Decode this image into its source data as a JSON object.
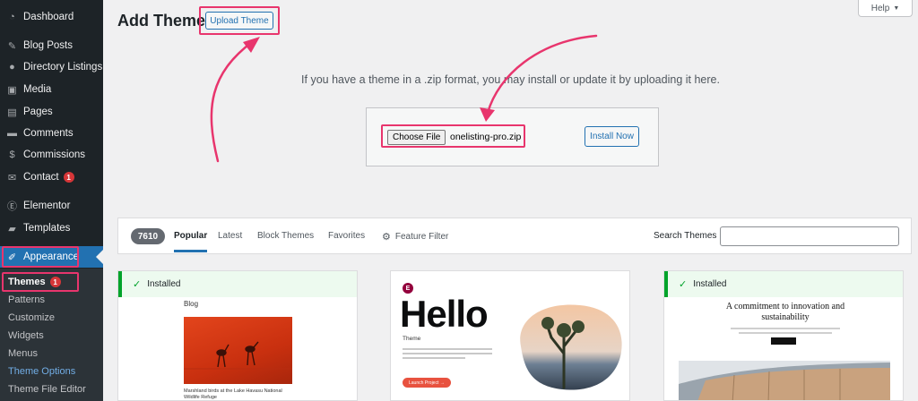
{
  "sidebar": {
    "items": [
      {
        "label": "Dashboard",
        "icon": "dashboard-icon"
      },
      {
        "label": "Blog Posts",
        "icon": "pin-icon"
      },
      {
        "label": "Directory Listings",
        "icon": "listing-icon"
      },
      {
        "label": "Media",
        "icon": "media-icon"
      },
      {
        "label": "Pages",
        "icon": "page-icon"
      },
      {
        "label": "Comments",
        "icon": "comment-icon"
      },
      {
        "label": "Commissions",
        "icon": "dollar-icon"
      },
      {
        "label": "Contact",
        "icon": "mail-icon",
        "badge": "1"
      },
      {
        "label": "Elementor",
        "icon": "elementor-icon"
      },
      {
        "label": "Templates",
        "icon": "folder-icon"
      },
      {
        "label": "Appearance",
        "icon": "brush-icon",
        "active": true
      }
    ],
    "submenu": [
      {
        "label": "Themes",
        "badge": "1",
        "current": true
      },
      {
        "label": "Patterns"
      },
      {
        "label": "Customize"
      },
      {
        "label": "Widgets"
      },
      {
        "label": "Menus"
      },
      {
        "label": "Theme Options"
      },
      {
        "label": "Theme File Editor"
      }
    ]
  },
  "header": {
    "title": "Add Themes",
    "upload_button": "Upload Theme",
    "help": "Help"
  },
  "upload": {
    "description": "If you have a theme in a .zip format, you may install or update it by uploading it here.",
    "choose_file": "Choose File",
    "file_name": "onelisting-pro.zip",
    "install_button": "Install Now"
  },
  "filter": {
    "count": "7610",
    "tabs": [
      "Popular",
      "Latest",
      "Block Themes",
      "Favorites"
    ],
    "feature_filter": "Feature Filter",
    "search_label": "Search Themes"
  },
  "cards": {
    "installed_label": "Installed",
    "card1": {
      "heading": "Blog",
      "caption": "Marshland birds at the Lake Havasu National Wildlife Refuge"
    },
    "card2": {
      "logo": "E",
      "title": "Hello",
      "subtitle": "Theme",
      "button": "Launch Project →"
    },
    "card3": {
      "heading": "A commitment to innovation and sustainability"
    }
  },
  "colors": {
    "accent": "#2271b1",
    "highlight": "#e8356d",
    "installed": "#00a32a",
    "badge": "#d63638"
  }
}
